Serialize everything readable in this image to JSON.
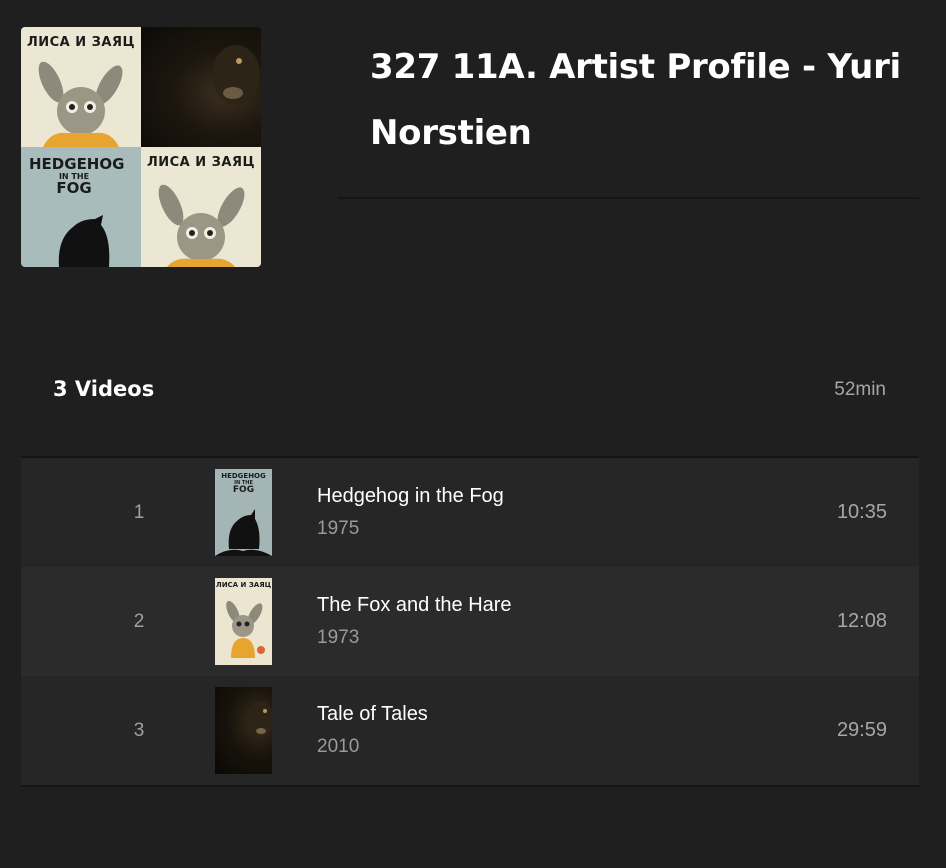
{
  "header": {
    "title": "327 11A. Artist Profile - Yuri Norstien",
    "cover_tiles": [
      {
        "name": "fox-and-hare",
        "label": "ЛИСА И ЗАЯЦ"
      },
      {
        "name": "tale-of-tales"
      },
      {
        "name": "hedgehog-in-the-fog",
        "label_top": "HEDGEHOG",
        "label_mid": "IN THE",
        "label_bottom": "FOG"
      },
      {
        "name": "fox-and-hare",
        "label": "ЛИСА И ЗАЯЦ"
      }
    ]
  },
  "summary": {
    "count": "3 Videos",
    "duration": "52min"
  },
  "videos": [
    {
      "number": "1",
      "title": "Hedgehog in the Fog",
      "year": "1975",
      "duration": "10:35",
      "thumb_label_top": "HEDGEHOG",
      "thumb_label_mid": "IN THE",
      "thumb_label_bottom": "FOG"
    },
    {
      "number": "2",
      "title": "The Fox and the Hare",
      "year": "1973",
      "duration": "12:08",
      "thumb_label": "ЛИСА И ЗАЯЦ"
    },
    {
      "number": "3",
      "title": "Tale of Tales",
      "year": "2010",
      "duration": "29:59"
    }
  ],
  "colors": {
    "background": "#1f1f1f",
    "row_alt": "#2b2b2b",
    "text_primary": "#ffffff",
    "text_secondary": "#a6a6a6"
  }
}
